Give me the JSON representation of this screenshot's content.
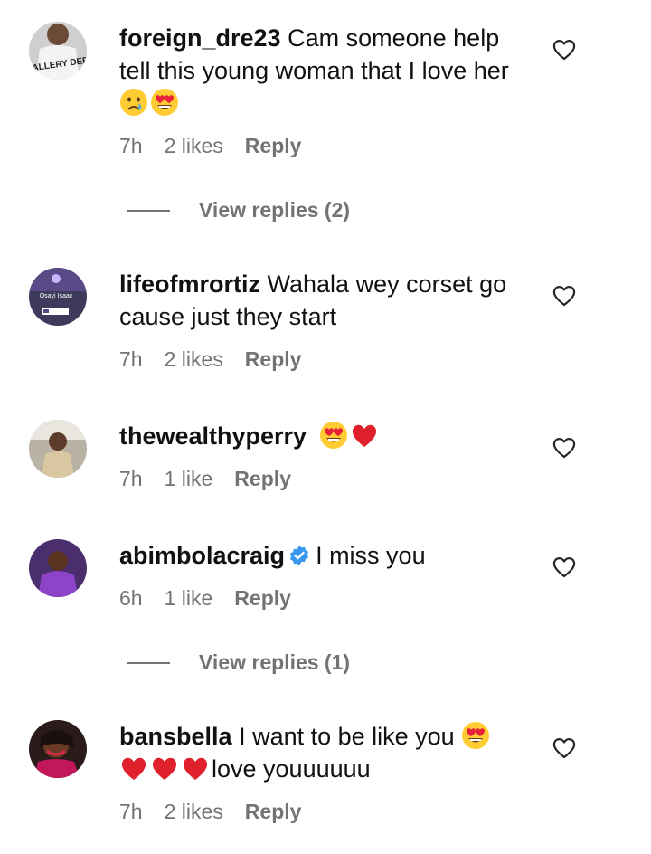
{
  "comments": [
    {
      "username": "foreign_dre23",
      "text": "Cam someone help tell this young woman that I love her",
      "emojis": [
        "crying-face-emoji",
        "heart-eyes-emoji"
      ],
      "time": "7h",
      "likes": "2 likes",
      "reply": "Reply",
      "avatar_text": "GALLERY DEPT",
      "replies_label": "View replies (2)"
    },
    {
      "username": "lifeofmrortiz",
      "text": "Wahala wey corset go cause just they start",
      "time": "7h",
      "likes": "2 likes",
      "reply": "Reply",
      "avatar_text": "Osayi Isaac"
    },
    {
      "username": "thewealthyperry",
      "text": "",
      "emojis": [
        "heart-eyes-emoji",
        "red-heart-emoji"
      ],
      "time": "7h",
      "likes": "1 like",
      "reply": "Reply"
    },
    {
      "username": "abimbolacraig",
      "verified": true,
      "text": "I miss you",
      "time": "6h",
      "likes": "1 like",
      "reply": "Reply",
      "replies_label": "View replies (1)"
    },
    {
      "username": "bansbella",
      "text_part1": "I want to be like you",
      "text_part2": "love youuuuuu",
      "emojis": [
        "heart-eyes-emoji",
        "red-heart-emoji",
        "red-heart-emoji",
        "red-heart-emoji"
      ],
      "time": "7h",
      "likes": "2 likes",
      "reply": "Reply"
    }
  ],
  "colors": {
    "text": "#111111",
    "secondary": "#737373",
    "verified": "#3897f0",
    "heart": "#e0202a"
  }
}
